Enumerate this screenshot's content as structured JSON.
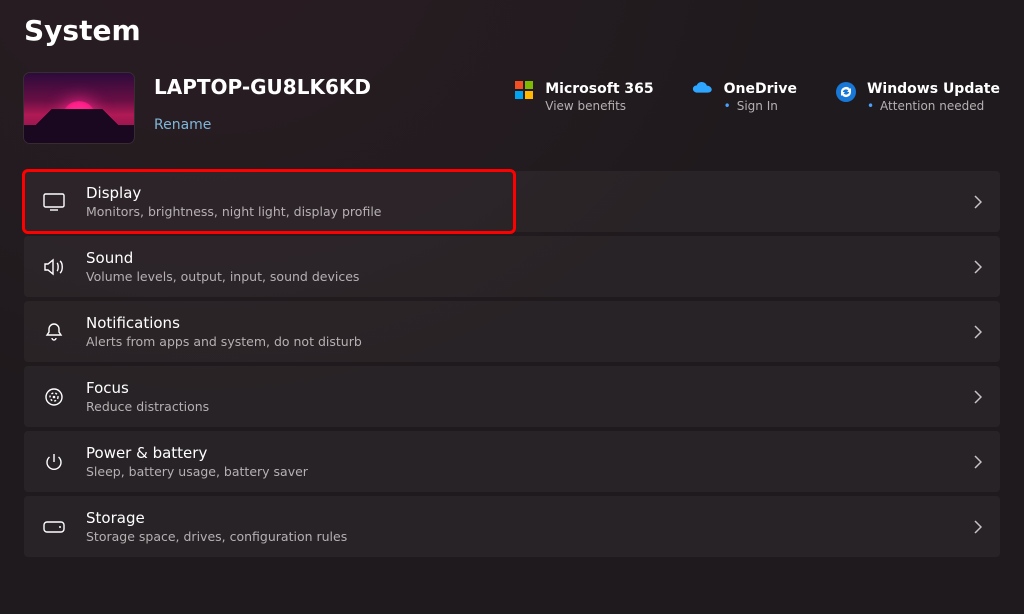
{
  "page_title": "System",
  "device": {
    "name": "LAPTOP-GU8LK6KD",
    "rename_label": "Rename"
  },
  "services": [
    {
      "id": "ms365",
      "title": "Microsoft 365",
      "subtitle": "View benefits",
      "bulleted": false
    },
    {
      "id": "onedrive",
      "title": "OneDrive",
      "subtitle": "Sign In",
      "bulleted": true
    },
    {
      "id": "winupdate",
      "title": "Windows Update",
      "subtitle": "Attention needed",
      "bulleted": true
    }
  ],
  "items": [
    {
      "id": "display",
      "title": "Display",
      "subtitle": "Monitors, brightness, night light, display profile",
      "highlighted": true
    },
    {
      "id": "sound",
      "title": "Sound",
      "subtitle": "Volume levels, output, input, sound devices",
      "highlighted": false
    },
    {
      "id": "notifications",
      "title": "Notifications",
      "subtitle": "Alerts from apps and system, do not disturb",
      "highlighted": false
    },
    {
      "id": "focus",
      "title": "Focus",
      "subtitle": "Reduce distractions",
      "highlighted": false
    },
    {
      "id": "power",
      "title": "Power & battery",
      "subtitle": "Sleep, battery usage, battery saver",
      "highlighted": false
    },
    {
      "id": "storage",
      "title": "Storage",
      "subtitle": "Storage space, drives, configuration rules",
      "highlighted": false
    }
  ]
}
